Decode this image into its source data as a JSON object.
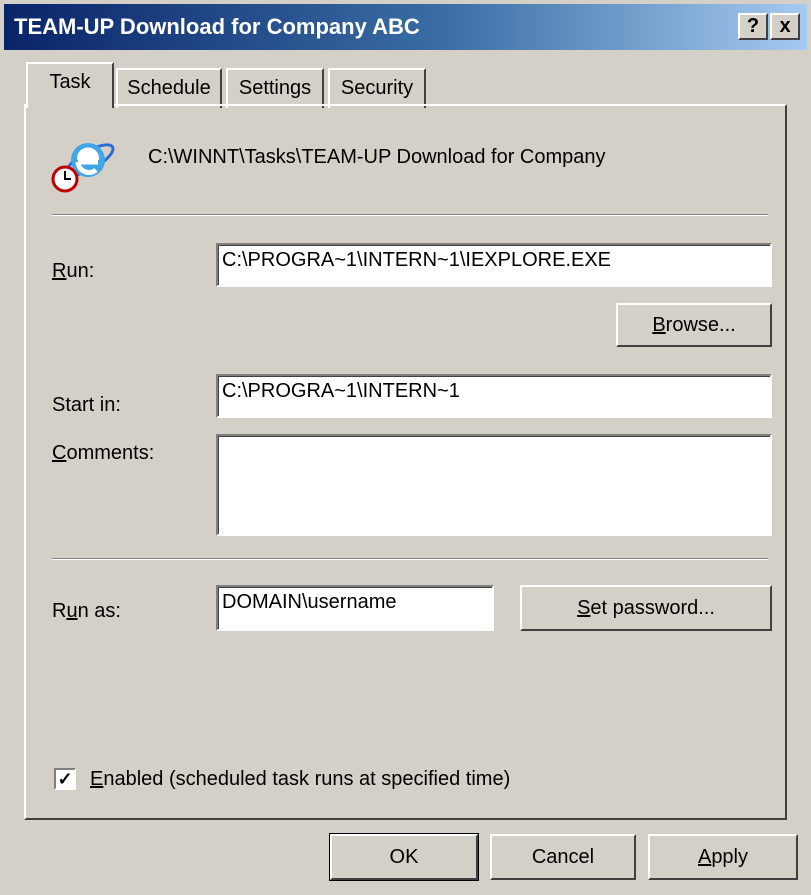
{
  "window": {
    "title": "TEAM-UP Download for Company ABC",
    "help_glyph": "?",
    "close_glyph": "x"
  },
  "tabs": [
    {
      "label": "Task",
      "active": true
    },
    {
      "label": "Schedule",
      "active": false
    },
    {
      "label": "Settings",
      "active": false
    },
    {
      "label": "Security",
      "active": false
    }
  ],
  "task": {
    "icon": "ie-scheduled-task-icon",
    "path": "C:\\WINNT\\Tasks\\TEAM-UP Download for Company",
    "run": {
      "label_key": "R",
      "label_rest": "un:",
      "value": "C:\\PROGRA~1\\INTERN~1\\IEXPLORE.EXE"
    },
    "browse": {
      "label_key": "B",
      "label_rest": "rowse..."
    },
    "start_in": {
      "label": "Start in:",
      "value": "C:\\PROGRA~1\\INTERN~1"
    },
    "comments": {
      "label_key": "C",
      "label_rest": "omments:",
      "value": ""
    },
    "run_as": {
      "label_pre": "R",
      "label_key": "u",
      "label_rest": "n as:",
      "value": "DOMAIN\\username"
    },
    "set_password": {
      "label_key": "S",
      "label_rest": "et password..."
    },
    "enabled": {
      "checked": true,
      "check_glyph": "✓",
      "label_key": "E",
      "label_rest": "nabled (scheduled task runs at specified time)"
    }
  },
  "buttons": {
    "ok": "OK",
    "cancel": "Cancel",
    "apply_key": "A",
    "apply_rest": "pply"
  },
  "colors": {
    "title_start": "#0a246a",
    "title_end": "#a6caf0",
    "face": "#d4d0c8"
  }
}
